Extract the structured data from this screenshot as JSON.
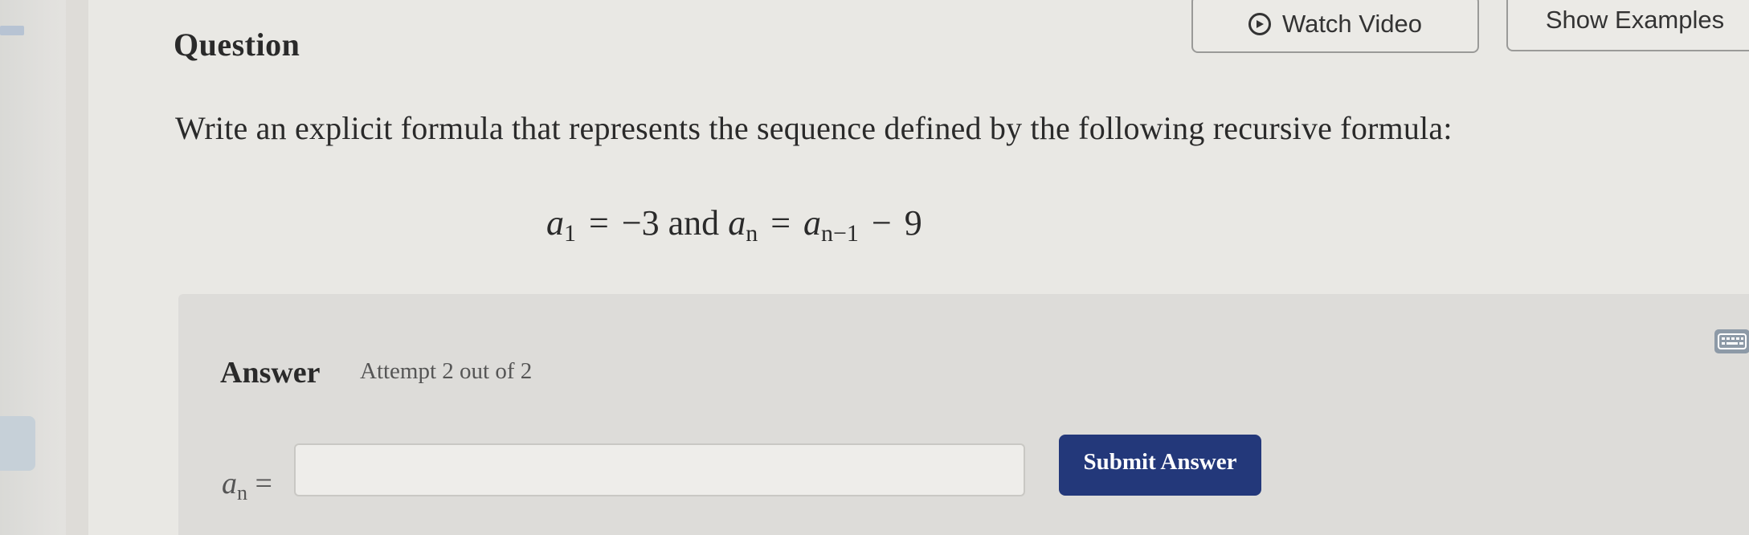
{
  "header": {
    "title": "Question",
    "watch_video_label": "Watch Video",
    "show_examples_label": "Show Examples"
  },
  "question": {
    "prompt": "Write an explicit formula that represents the sequence defined by the following recursive formula:",
    "formula": {
      "first_term_var": "a",
      "first_term_sub": "1",
      "equals": "=",
      "first_term_value": "−3",
      "connector": "and",
      "general_var": "a",
      "general_sub": "n",
      "prev_var": "a",
      "prev_sub": "n−1",
      "minus": "−",
      "difference": "9"
    }
  },
  "answer": {
    "label": "Answer",
    "attempt_text": "Attempt 2 out of 2",
    "input_prefix_var": "a",
    "input_prefix_sub": "n",
    "input_prefix_eq": "=",
    "input_value": "",
    "submit_label": "Submit Answer"
  },
  "colors": {
    "background": "#e9e8e4",
    "answer_panel": "#dddcd9",
    "submit_button": "#23387a"
  },
  "icons": [
    "play-circle-icon",
    "keyboard-icon"
  ]
}
